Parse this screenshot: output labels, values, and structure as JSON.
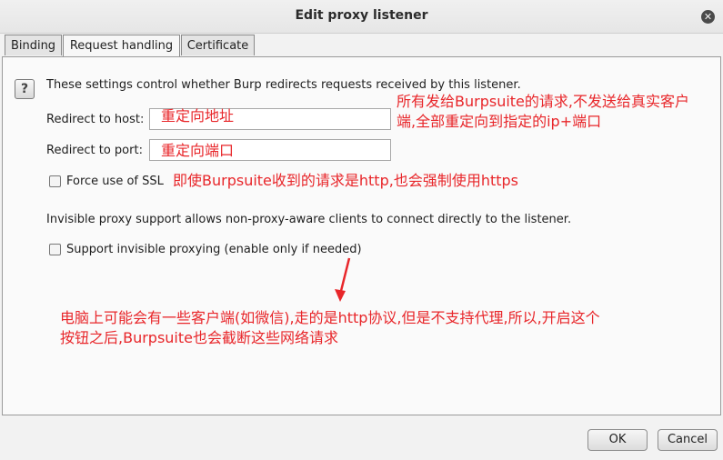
{
  "window": {
    "title": "Edit proxy listener"
  },
  "tabs": [
    {
      "label": "Binding"
    },
    {
      "label": "Request handling"
    },
    {
      "label": "Certificate"
    }
  ],
  "main": {
    "description": "These settings control whether Burp redirects requests received by this listener.",
    "redirect_host": {
      "label": "Redirect to host:",
      "value": ""
    },
    "redirect_port": {
      "label": "Redirect to port:",
      "value": ""
    },
    "force_ssl": {
      "label": "Force use of SSL",
      "checked": false
    },
    "invisible_desc": "Invisible proxy support allows non-proxy-aware clients to connect directly to the listener.",
    "invisible": {
      "label": "Support invisible proxying (enable only if needed)",
      "checked": false
    }
  },
  "annotations": {
    "host_field": "重定向地址",
    "port_field": "重定向端口",
    "redirect_note_line1": "所有发给Burpsuite的请求,不发送给真实客户",
    "redirect_note_line2": "端,全部重定向到指定的ip+端口",
    "ssl_note": "即使Burpsuite收到的请求是http,也会强制使用https",
    "invisible_note_line1": "电脑上可能会有一些客户端(如微信),走的是http协议,但是不支持代理,所以,开启这个",
    "invisible_note_line2": "按钮之后,Burpsuite也会截断这些网络请求",
    "color": "#e8262a"
  },
  "buttons": {
    "ok": "OK",
    "cancel": "Cancel"
  }
}
